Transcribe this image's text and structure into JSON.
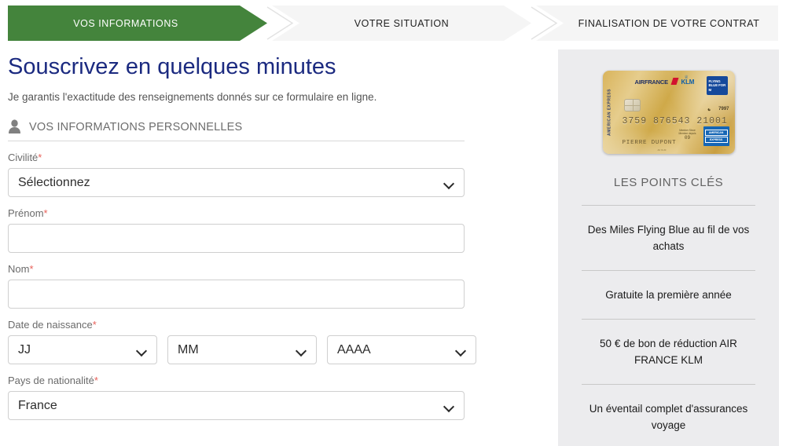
{
  "stepper": {
    "steps": [
      {
        "label": "VOS INFORMATIONS",
        "state": "active"
      },
      {
        "label": "VOTRE SITUATION",
        "state": "idle"
      },
      {
        "label": "FINALISATION DE VOTRE CONTRAT",
        "state": "idle"
      }
    ],
    "active_color": "#44843c",
    "idle_color": "#f5f5f5"
  },
  "main": {
    "title": "Souscrivez en quelques minutes",
    "subtitle": "Je garantis l'exactitude des renseignements donnés sur ce formulaire en ligne.",
    "section_heading": "VOS INFORMATIONS PERSONNELLES",
    "section_icon": "person-icon",
    "required_marker": "*",
    "title_color": "#1b2a80",
    "fields": {
      "civilite": {
        "label": "Civilité",
        "value": "Sélectionnez",
        "type": "select"
      },
      "prenom": {
        "label": "Prénom",
        "value": "",
        "type": "input"
      },
      "nom": {
        "label": "Nom",
        "value": "",
        "type": "input"
      },
      "date_naissance": {
        "label": "Date de naissance",
        "day": "JJ",
        "month": "MM",
        "year": "AAAA"
      },
      "pays": {
        "label": "Pays de nationalité",
        "value": "France",
        "type": "select"
      }
    }
  },
  "sidebar": {
    "title": "LES POINTS CLÉS",
    "background": "#ececee",
    "key_points": [
      "Des Miles Flying Blue au fil de vos achats",
      "Gratuite la première année",
      "50 € de bon de réduction AIR FRANCE KLM",
      "Un éventail complet d'assurances voyage"
    ],
    "card": {
      "vertical_brand": "AMERICAN EXPRESS",
      "airline_1": "AIRFRANCE",
      "airline_2": "KLM",
      "program_badge": "FLYING BLUE FOR M",
      "last_four": "7997",
      "number": "3759 876543 21001",
      "member_since_label": "Member Since Membre depuis",
      "member_since_value": "09",
      "holder_name": "PIERRE DUPONT",
      "network_line_1": "AMERICAN",
      "network_line_2": "EXPRESS",
      "footnote": "AF KLM"
    }
  }
}
